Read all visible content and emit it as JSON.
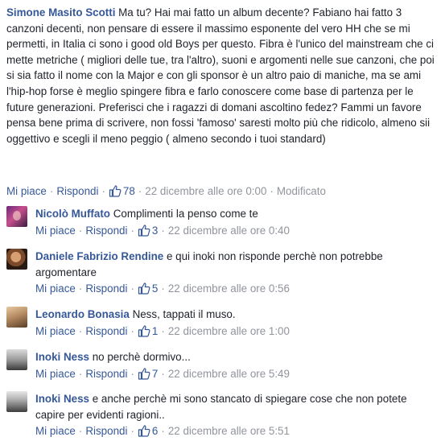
{
  "top_comment": {
    "author": "Simone Masito Scotti",
    "text": "Ma tu? Hai mai fatto un album decente? Fabiano hai fatto 3 canzoni decenti, non pensare di essere il massimo esponente del vero HH che se mi permetti, in Italia ci sono i good old Boys per questo. Fibra è l'unico del mainstream che ci mette metriche ( migliori delle tue, tra l'altro), suoni e argomenti nelle sue canzoni, che poi si sia fatto il nome con la Major e con gli sponsor è un altro paio di maniche, ma se ami l'hip-hop forse è meglio spingere fibra e farlo conoscere come base di partenza per le future generazioni. Preferisci che i ragazzi di domani ascoltino fedez? Fammi un favore pensa bene prima di scrivere, non fossi 'famoso' saresti molto più che ridicolo, almeno sii oggettivo e scegli il meno peggio ( almeno secondo i tuoi standard)",
    "like_label": "Mi piace",
    "reply_label": "Rispondi",
    "likes": "78",
    "timestamp": "22 dicembre alle ore 0:00",
    "edited": "Modificato"
  },
  "replies": [
    {
      "author": "Nicolò Muffato",
      "text": "Complimenti la penso come te",
      "like_label": "Mi piace",
      "reply_label": "Rispondi",
      "likes": "3",
      "timestamp": "22 dicembre alle ore 0:40"
    },
    {
      "author": "Daniele Fabrizio Rendine",
      "text": "e qui inoki non risponde perchè non potrebbe argomentare",
      "like_label": "Mi piace",
      "reply_label": "Rispondi",
      "likes": "5",
      "timestamp": "22 dicembre alle ore 0:56"
    },
    {
      "author": "Leonardo Bonasia",
      "text": "Ness, tappati il muso.",
      "like_label": "Mi piace",
      "reply_label": "Rispondi",
      "likes": "1",
      "timestamp": "22 dicembre alle ore 1:00"
    },
    {
      "author": "Inoki Ness",
      "text": "no perchè dormivo...",
      "like_label": "Mi piace",
      "reply_label": "Rispondi",
      "likes": "7",
      "timestamp": "22 dicembre alle ore 5:49"
    },
    {
      "author": "Inoki Ness",
      "text": "e anche perchè mi sono stancato di spiegare cose che non potete capire per evidenti ragioni..",
      "like_label": "Mi piace",
      "reply_label": "Rispondi",
      "likes": "6",
      "timestamp": "22 dicembre alle ore 5:51"
    }
  ],
  "colors": {
    "link": "#365899",
    "meta": "#90949c",
    "text": "#1d2129"
  }
}
